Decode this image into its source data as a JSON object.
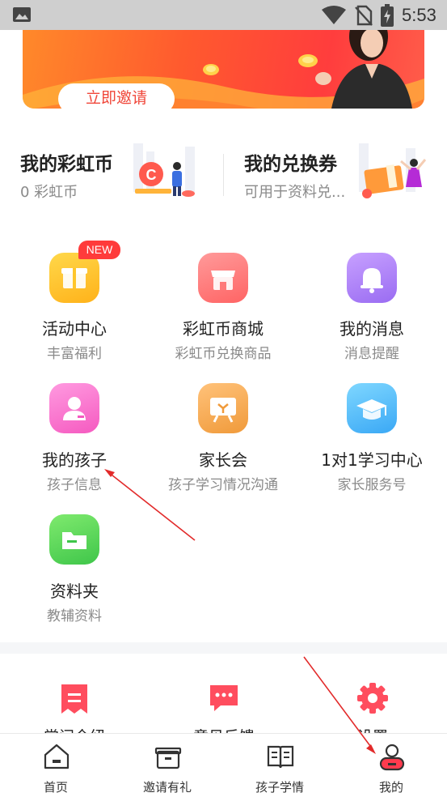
{
  "status_bar": {
    "time": "5:53"
  },
  "banner": {
    "invite_label": "立即邀请"
  },
  "cards": [
    {
      "title": "我的彩虹币",
      "sub": "0 彩虹币"
    },
    {
      "title": "我的兑换券",
      "sub": "可用于资料兑..."
    }
  ],
  "new_badge": "NEW",
  "grid": [
    {
      "label": "活动中心",
      "sub": "丰富福利",
      "icon": "gift-icon"
    },
    {
      "label": "彩虹币商城",
      "sub": "彩虹币兑换商品",
      "icon": "store-icon"
    },
    {
      "label": "我的消息",
      "sub": "消息提醒",
      "icon": "bell-icon"
    },
    {
      "label": "我的孩子",
      "sub": "孩子信息",
      "icon": "child-icon"
    },
    {
      "label": "家长会",
      "sub": "孩子学习情况沟通",
      "icon": "meeting-board-icon"
    },
    {
      "label": "1对1学习中心",
      "sub": "家长服务号",
      "icon": "graduation-cap-icon"
    },
    {
      "label": "资料夹",
      "sub": "教辅资料",
      "icon": "folder-icon"
    }
  ],
  "bottom_grid": [
    {
      "label": "常问今纽",
      "icon": "receipt-icon"
    },
    {
      "label": "意见反馈",
      "icon": "chat-icon"
    },
    {
      "label": "设置",
      "icon": "gear-icon"
    }
  ],
  "tabs": [
    {
      "label": "首页",
      "icon": "home-icon"
    },
    {
      "label": "邀请有礼",
      "icon": "gift-box-icon"
    },
    {
      "label": "孩子学情",
      "icon": "book-icon"
    },
    {
      "label": "我的",
      "icon": "profile-icon",
      "active": true
    }
  ],
  "colors": {
    "accent": "#ff3b3b",
    "banner_start": "#ff8a2a",
    "banner_end": "#ff3d3d"
  }
}
